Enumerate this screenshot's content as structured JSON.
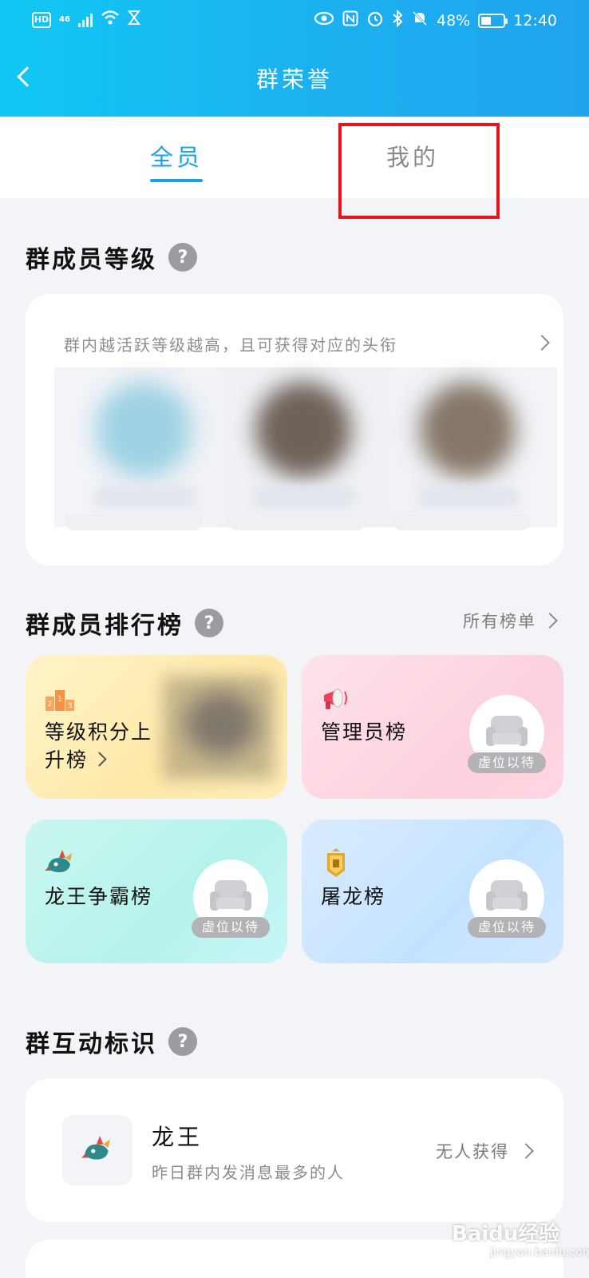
{
  "status_bar": {
    "hd": "HD",
    "network": "46",
    "battery": "48%",
    "battery_level": 0.48,
    "time": "12:40",
    "icons": [
      "eye-icon",
      "nfc-icon",
      "alarm-icon",
      "bluetooth-icon",
      "mute-icon"
    ]
  },
  "header": {
    "title": "群荣誉"
  },
  "tabs": [
    {
      "label": "全员",
      "active": true
    },
    {
      "label": "我的",
      "active": false
    }
  ],
  "level_section": {
    "title": "群成员等级",
    "help_label": "?",
    "desc": "群内越活跃等级越高，且可获得对应的头衔"
  },
  "ranking_section": {
    "title": "群成员排行榜",
    "help_label": "?",
    "all_lists_label": "所有榜单",
    "cards": [
      {
        "label_line1": "等级积分上",
        "label_line2": "升榜",
        "icon": "podium-icon",
        "color": "#ffe9a9"
      },
      {
        "label": "管理员榜",
        "vacant": "虚位以待",
        "icon": "megaphone-icon",
        "color": "#fcd0dc"
      },
      {
        "label": "龙王争霸榜",
        "vacant": "虚位以待",
        "icon": "dragon-icon",
        "color": "#b5f2ec"
      },
      {
        "label": "屠龙榜",
        "vacant": "虚位以待",
        "icon": "badge-icon",
        "color": "#c4e2ff"
      }
    ]
  },
  "interaction_section": {
    "title": "群互动标识",
    "help_label": "?",
    "item": {
      "title": "龙王",
      "desc": "昨日群内发消息最多的人",
      "status": "无人获得",
      "icon": "dragon-icon"
    }
  },
  "colors": {
    "header": "#1bb2f0",
    "accent": "#19a2e8",
    "highlight": "#e8141a",
    "background": "#f3f4f8"
  },
  "watermark": {
    "text": "Baidu经验",
    "sub": "jingyan.baidu.com"
  }
}
